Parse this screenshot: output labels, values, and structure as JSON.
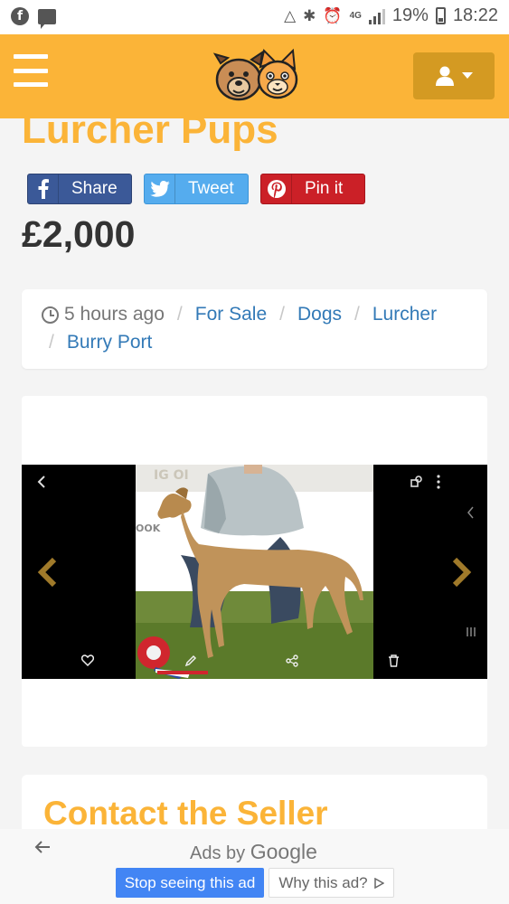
{
  "status_bar": {
    "battery": "19%",
    "time": "18:22",
    "network": "4G",
    "icons": [
      "facebook-icon",
      "message-icon",
      "data-saver-icon",
      "bluetooth-icon",
      "alarm-icon",
      "network-4g-icon",
      "signal-icon",
      "battery-icon"
    ]
  },
  "header": {
    "menu_icon": "hamburger-icon",
    "logo": "dog-and-cat-logo",
    "user_icon": "user-icon",
    "caret_icon": "caret-down-icon",
    "brand_color": "#fbb438",
    "user_button_color": "#d49a22"
  },
  "listing": {
    "title": "Lurcher Pups",
    "price": "£2,000"
  },
  "share": {
    "facebook": "Share",
    "twitter": "Tweet",
    "pinterest": "Pin it",
    "colors": {
      "facebook": "#3b5998",
      "twitter": "#55acee",
      "pinterest": "#cb2027"
    }
  },
  "breadcrumb": {
    "time": "5 hours ago",
    "items": [
      "For Sale",
      "Dogs",
      "Lurcher",
      "Burry Port"
    ],
    "link_color": "#337ab7"
  },
  "gallery": {
    "prev_icon": "chevron-left-icon",
    "next_icon": "chevron-right-icon",
    "arrow_color": "#a07a2a",
    "overlay_icons": [
      "back-icon",
      "cast-icon",
      "more-icon",
      "heart-icon",
      "edit-icon",
      "share-icon",
      "trash-icon"
    ]
  },
  "contact": {
    "title": "Contact the Seller"
  },
  "ad": {
    "ads_by": "Ads by",
    "google": "Google",
    "stop_label": "Stop seeing this ad",
    "why_label": "Why this ad?",
    "back_icon": "arrow-left-icon"
  }
}
